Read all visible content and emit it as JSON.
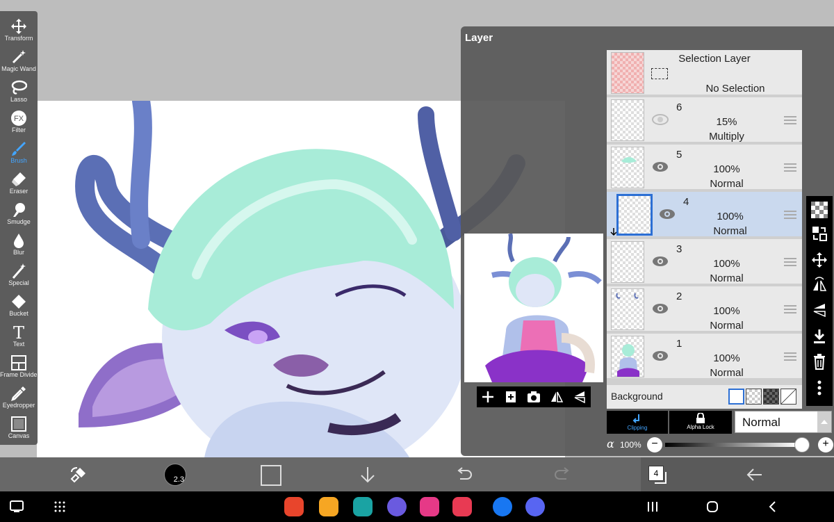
{
  "tools": [
    {
      "name": "transform",
      "label": "Transform",
      "icon": "move-arrows-icon"
    },
    {
      "name": "magic-wand",
      "label": "Magic Wand",
      "icon": "magic-wand-icon"
    },
    {
      "name": "lasso",
      "label": "Lasso",
      "icon": "lasso-icon"
    },
    {
      "name": "filter",
      "label": "Filter",
      "icon": "fx-icon",
      "glyph": "FX"
    },
    {
      "name": "brush",
      "label": "Brush",
      "icon": "brush-icon",
      "active": true
    },
    {
      "name": "eraser",
      "label": "Eraser",
      "icon": "eraser-icon"
    },
    {
      "name": "smudge",
      "label": "Smudge",
      "icon": "smudge-icon"
    },
    {
      "name": "blur",
      "label": "Blur",
      "icon": "drop-icon"
    },
    {
      "name": "special",
      "label": "Special",
      "icon": "special-pen-icon"
    },
    {
      "name": "bucket",
      "label": "Bucket",
      "icon": "bucket-icon"
    },
    {
      "name": "text",
      "label": "Text",
      "icon": "text-icon",
      "glyph": "T"
    },
    {
      "name": "frame-divider",
      "label": "Frame Divider",
      "icon": "frame-divider-icon"
    },
    {
      "name": "eyedropper",
      "label": "Eyedropper",
      "icon": "eyedropper-icon"
    },
    {
      "name": "canvas",
      "label": "Canvas",
      "icon": "canvas-icon"
    }
  ],
  "layer_panel": {
    "title": "Layer",
    "selection_layer": {
      "title": "Selection Layer",
      "status": "No Selection"
    },
    "layers": [
      {
        "number": "6",
        "opacity": "15%",
        "mode": "Multiply",
        "selected": false
      },
      {
        "number": "5",
        "opacity": "100%",
        "mode": "Normal",
        "selected": false
      },
      {
        "number": "4",
        "opacity": "100%",
        "mode": "Normal",
        "selected": true
      },
      {
        "number": "3",
        "opacity": "100%",
        "mode": "Normal",
        "selected": false
      },
      {
        "number": "2",
        "opacity": "100%",
        "mode": "Normal",
        "selected": false
      },
      {
        "number": "1",
        "opacity": "100%",
        "mode": "Normal",
        "selected": false
      }
    ],
    "background_label": "Background",
    "clipping_label": "Clipping",
    "alpha_lock_label": "Alpha Lock",
    "blend_mode": "Normal",
    "alpha_symbol": "α",
    "opacity_value": "100%",
    "minus": "−",
    "plus": "+"
  },
  "bottom_bar": {
    "brush_size": "2.3",
    "layer_count": "4"
  },
  "colors": {
    "accent_blue": "#43a5ff",
    "selected_layer": "#cad9ee",
    "panel_bg": "#585858"
  }
}
